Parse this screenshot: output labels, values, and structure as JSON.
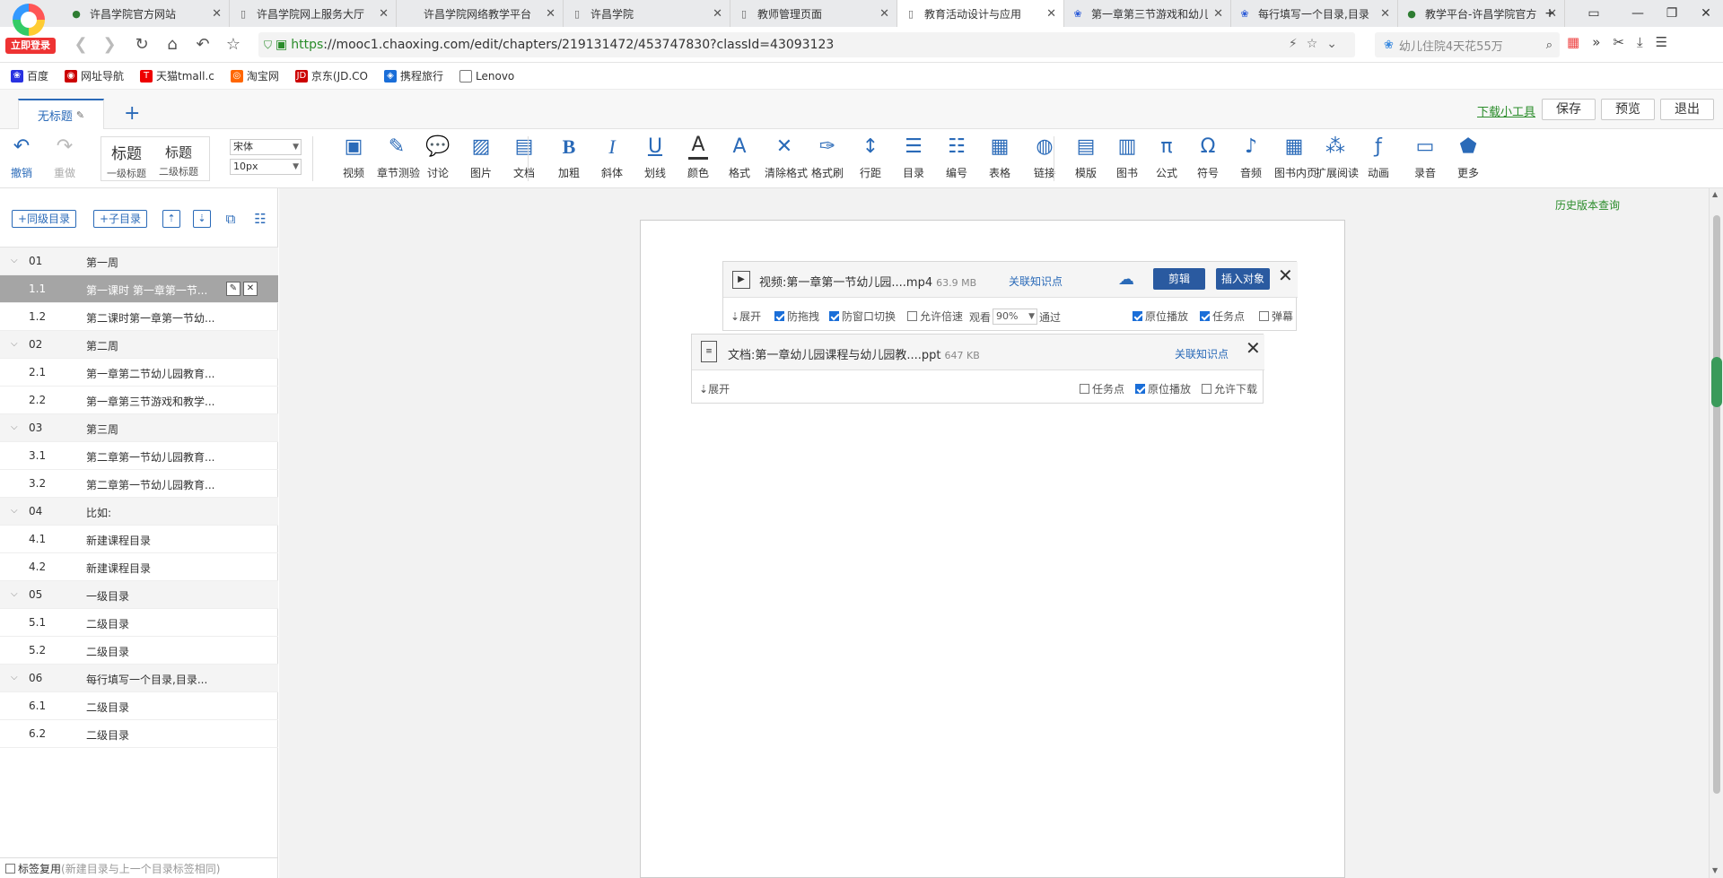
{
  "browser": {
    "login_label": "立即登录",
    "tabs": [
      {
        "title": "许昌学院官方网站",
        "icon": "seal"
      },
      {
        "title": "许昌学院网上服务大厅",
        "icon": "doc"
      },
      {
        "title": "许昌学院网络教学平台",
        "icon": "blank"
      },
      {
        "title": "许昌学院",
        "icon": "doc"
      },
      {
        "title": "教师管理页面",
        "icon": "doc"
      },
      {
        "title": "教育活动设计与应用",
        "icon": "doc",
        "active": true
      },
      {
        "title": "第一章第三节游戏和幼儿",
        "icon": "paw"
      },
      {
        "title": "每行填写一个目录,目录",
        "icon": "paw"
      },
      {
        "title": "教学平台-许昌学院官方",
        "icon": "seal"
      }
    ],
    "url_scheme": "https",
    "url_rest": "://mooc1.chaoxing.com/edit/chapters/219131472/453747830?classId=43093123",
    "search_text": "幼儿住院4天花55万",
    "bookmarks": [
      "百度",
      "网址导航",
      "天猫tmall.c",
      "淘宝网",
      "京东(JD.CO",
      "携程旅行",
      "Lenovo"
    ]
  },
  "header": {
    "doc_title": "无标题",
    "download_tool": "下载小工具",
    "save": "保存",
    "preview": "预览",
    "exit": "退出"
  },
  "toolbar": {
    "undo": "撤销",
    "redo": "重做",
    "heading1_big": "标题",
    "heading1_small": "一级标题",
    "heading2_big": "标题",
    "heading2_small": "二级标题",
    "font_family": "宋体",
    "font_size": "10px",
    "tools": [
      "视频",
      "章节测验",
      "讨论",
      "图片",
      "文档",
      "加粗",
      "斜体",
      "划线",
      "颜色",
      "格式",
      "清除格式",
      "格式刷",
      "行距",
      "目录",
      "编号",
      "表格",
      "链接",
      "模版",
      "图书",
      "公式",
      "符号",
      "音频",
      "图书内页",
      "扩展阅读",
      "动画",
      "录音",
      "更多"
    ]
  },
  "sidebar": {
    "add_sibling": "+同级目录",
    "add_child": "+子目录",
    "tree": [
      {
        "type": "chapter",
        "num": "01",
        "label": "第一周"
      },
      {
        "type": "section",
        "num": "1.1",
        "label": "第一课时 第一章第一节...",
        "active": true
      },
      {
        "type": "section",
        "num": "1.2",
        "label": "第二课时第一章第一节幼..."
      },
      {
        "type": "chapter",
        "num": "02",
        "label": "第二周"
      },
      {
        "type": "section",
        "num": "2.1",
        "label": "第一章第二节幼儿园教育..."
      },
      {
        "type": "section",
        "num": "2.2",
        "label": "第一章第三节游戏和教学..."
      },
      {
        "type": "chapter",
        "num": "03",
        "label": "第三周"
      },
      {
        "type": "section",
        "num": "3.1",
        "label": "第二章第一节幼儿园教育..."
      },
      {
        "type": "section",
        "num": "3.2",
        "label": "第二章第一节幼儿园教育..."
      },
      {
        "type": "chapter",
        "num": "04",
        "label": "比如:"
      },
      {
        "type": "section",
        "num": "4.1",
        "label": "新建课程目录"
      },
      {
        "type": "section",
        "num": "4.2",
        "label": "新建课程目录"
      },
      {
        "type": "chapter",
        "num": "05",
        "label": "一级目录"
      },
      {
        "type": "section",
        "num": "5.1",
        "label": "二级目录"
      },
      {
        "type": "section",
        "num": "5.2",
        "label": "二级目录"
      },
      {
        "type": "chapter",
        "num": "06",
        "label": "每行填写一个目录,目录..."
      },
      {
        "type": "section",
        "num": "6.1",
        "label": "二级目录"
      },
      {
        "type": "section",
        "num": "6.2",
        "label": "二级目录"
      }
    ],
    "reuse_label": "标签复用",
    "reuse_hint": "(新建目录与上一个目录标签相同)"
  },
  "editor": {
    "history": "历史版本查询",
    "video": {
      "title": "视频:第一章第一节幼儿园....mp4",
      "size": "63.9 MB",
      "link": "关联知识点",
      "edit": "剪辑",
      "insert": "插入对象",
      "expand": "展开",
      "anti_drag": "防拖拽",
      "anti_switch": "防窗口切换",
      "allow_speed": "允许倍速",
      "watch": "观看",
      "percent": "90%",
      "pass": "通过",
      "in_place": "原位播放",
      "task_point": "任务点",
      "danmaku": "弹幕"
    },
    "document": {
      "title": "文档:第一章幼儿园课程与幼儿园教....ppt",
      "size": "647 KB",
      "link": "关联知识点",
      "expand": "展开",
      "task_point": "任务点",
      "in_place": "原位播放",
      "allow_download": "允许下载"
    }
  }
}
